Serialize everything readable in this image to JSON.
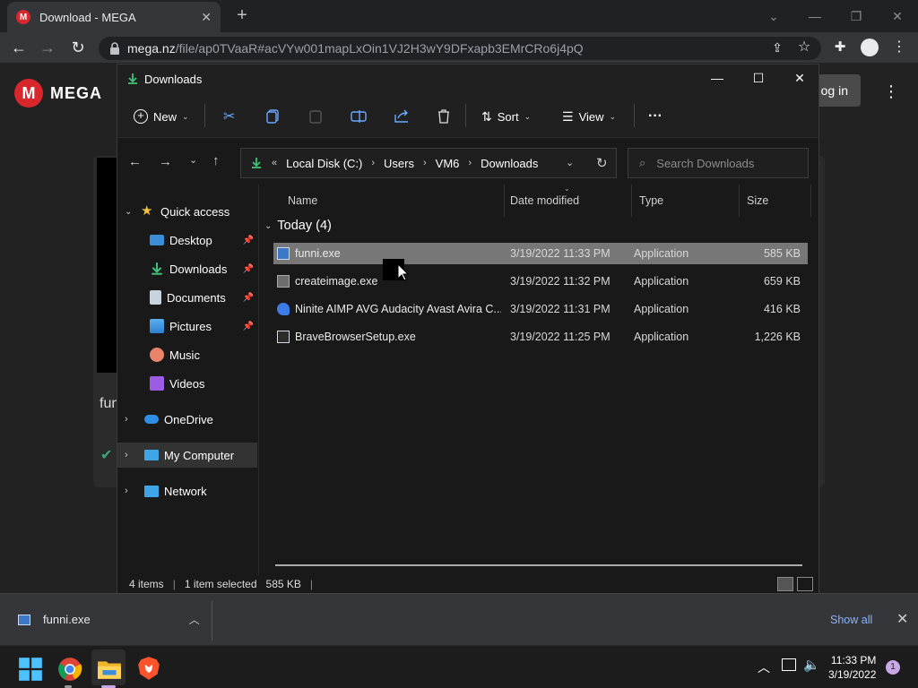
{
  "browser": {
    "tab_title": "Download - MEGA",
    "url_host": "mega.nz",
    "url_path": "/file/ap0TVaaR#acVYw001mapLxOin1VJ2H3wY9DFxapb3EMrCRo6j4pQ",
    "icons": [
      "back-icon",
      "forward-icon",
      "reload-icon",
      "lock-icon",
      "share-icon",
      "star-icon",
      "extensions-icon",
      "profile-icon",
      "menu-icon"
    ]
  },
  "mega": {
    "brand": "MEGA",
    "login_label": "og in",
    "card_text": "funi",
    "accent": "#d9272e"
  },
  "explorer": {
    "title": "Downloads",
    "toolbar": {
      "new_label": "New",
      "sort_label": "Sort",
      "view_label": "View",
      "more_label": "···"
    },
    "breadcrumb": [
      "Local Disk (C:)",
      "Users",
      "VM6",
      "Downloads"
    ],
    "breadcrumb_prefix": "«",
    "search_placeholder": "Search Downloads",
    "nav": {
      "quick_access": "Quick access",
      "items": [
        "Desktop",
        "Downloads",
        "Documents",
        "Pictures",
        "Music",
        "Videos"
      ],
      "onedrive": "OneDrive",
      "my_computer": "My Computer",
      "network": "Network"
    },
    "columns": {
      "name": "Name",
      "date": "Date modified",
      "type": "Type",
      "size": "Size"
    },
    "group_label": "Today (4)",
    "files": [
      {
        "name": "funni.exe",
        "date": "3/19/2022 11:33 PM",
        "type": "Application",
        "size": "585 KB",
        "selected": true
      },
      {
        "name": "createimage.exe",
        "date": "3/19/2022 11:32 PM",
        "type": "Application",
        "size": "659 KB",
        "selected": false
      },
      {
        "name": "Ninite AIMP AVG Audacity Avast Avira C...",
        "date": "3/19/2022 11:31 PM",
        "type": "Application",
        "size": "416 KB",
        "selected": false
      },
      {
        "name": "BraveBrowserSetup.exe",
        "date": "3/19/2022 11:25 PM",
        "type": "Application",
        "size": "1,226 KB",
        "selected": false
      }
    ],
    "status": {
      "items": "4 items",
      "selected": "1 item selected",
      "size": "585 KB"
    }
  },
  "download_bar": {
    "file": "funni.exe",
    "show_all": "Show all"
  },
  "taskbar": {
    "time": "11:33 PM",
    "date": "3/19/2022",
    "notifications": "1",
    "apps": [
      "start-icon",
      "chrome-icon",
      "file-explorer-icon",
      "brave-icon"
    ]
  }
}
